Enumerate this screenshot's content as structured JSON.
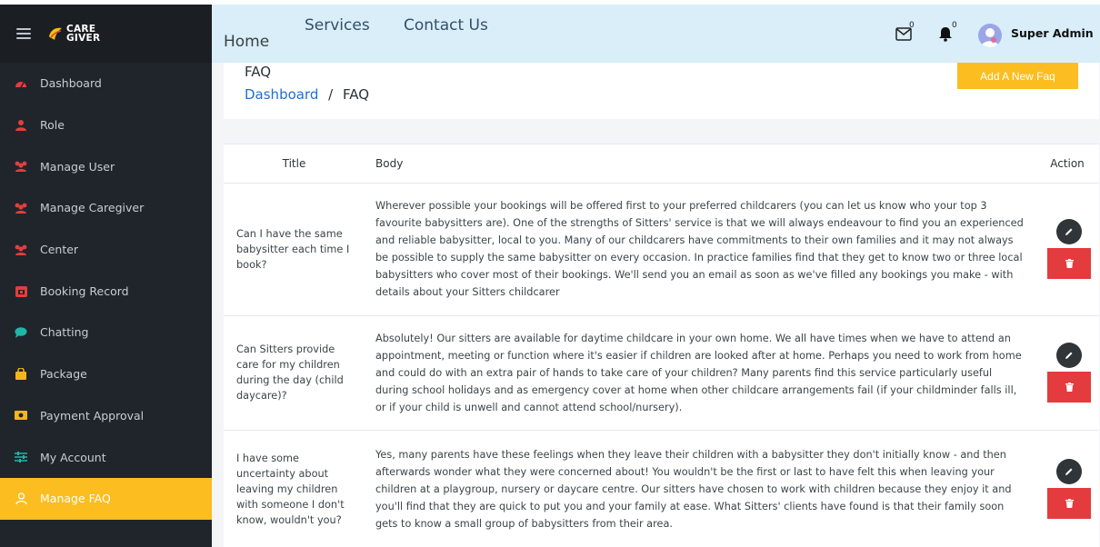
{
  "sidebar": {
    "logo_top": "CARE",
    "logo_bottom": "GIVER",
    "items": [
      {
        "label": "Dashboard",
        "icon": "tachometer-icon"
      },
      {
        "label": "Role",
        "icon": "user-icon"
      },
      {
        "label": "Manage User",
        "icon": "users-icon"
      },
      {
        "label": "Manage Caregiver",
        "icon": "users-icon"
      },
      {
        "label": "Center",
        "icon": "users-icon"
      },
      {
        "label": "Booking Record",
        "icon": "calendar-icon"
      },
      {
        "label": "Chatting",
        "icon": "chat-bubble-icon"
      },
      {
        "label": "Package",
        "icon": "shopping-bag-icon"
      },
      {
        "label": "Payment Approval",
        "icon": "money-icon"
      },
      {
        "label": "My Account",
        "icon": "sliders-icon"
      },
      {
        "label": "Manage FAQ",
        "icon": "person-outline-icon"
      }
    ]
  },
  "navbar": {
    "home": "Home",
    "services": "Services",
    "contact": "Contact Us",
    "messages_count": "0",
    "notifications_count": "0",
    "user_name": "Super Admin"
  },
  "header": {
    "title": "FAQ",
    "breadcrumb_link": "Dashboard",
    "breadcrumb_sep": "/",
    "breadcrumb_current": "FAQ",
    "add_button": "Add A New Faq"
  },
  "table": {
    "columns": [
      "Title",
      "Body",
      "Action"
    ],
    "rows": [
      {
        "title": "Can I have the same babysitter each time I book?",
        "body": "Wherever possible your bookings will be offered first to your preferred childcarers (you can let us know who your top 3 favourite babysitters are). One of the strengths of Sitters' service is that we will always endeavour to find you an experienced and reliable babysitter, local to you. Many of our childcarers have commitments to their own families and it may not always be possible to supply the same babysitter on every occasion. In practice families find that they get to know two or three local babysitters who cover most of their bookings. We'll send you an email as soon as we've filled any bookings you make - with details about your Sitters childcarer"
      },
      {
        "title": "Can Sitters provide care for my children during the day (child daycare)?",
        "body": "Absolutely! Our sitters are available for daytime childcare in your own home. We all have times when we have to attend an appointment, meeting or function where it's easier if children are looked after at home. Perhaps you need to work from home and could do with an extra pair of hands to take care of your children? Many parents find this service particularly useful during school holidays and as emergency cover at home when other childcare arrangements fail (if your childminder falls ill, or if your child is unwell and cannot attend school/nursery)."
      },
      {
        "title": "I have some uncertainty about leaving my children with someone I don't know, wouldn't you?",
        "body": "Yes, many parents have these feelings when they leave their children with a babysitter they don't initially know - and then afterwards wonder what they were concerned about! You wouldn't be the first or last to have felt this when leaving your children at a playgroup, nursery or daycare centre. Our sitters have chosen to work with children because they enjoy it and you'll find that they are quick to put you and your family at ease. What Sitters' clients have found is that their family soon gets to know a small group of babysitters from their area."
      }
    ]
  },
  "colors": {
    "sidebar_bg": "#20252b",
    "accent": "#fbbd1f",
    "navbar_bg": "#d9eef9",
    "link": "#1f6fd0",
    "delete": "#e43b3f",
    "sidebar_icon": "#e33e3e"
  }
}
